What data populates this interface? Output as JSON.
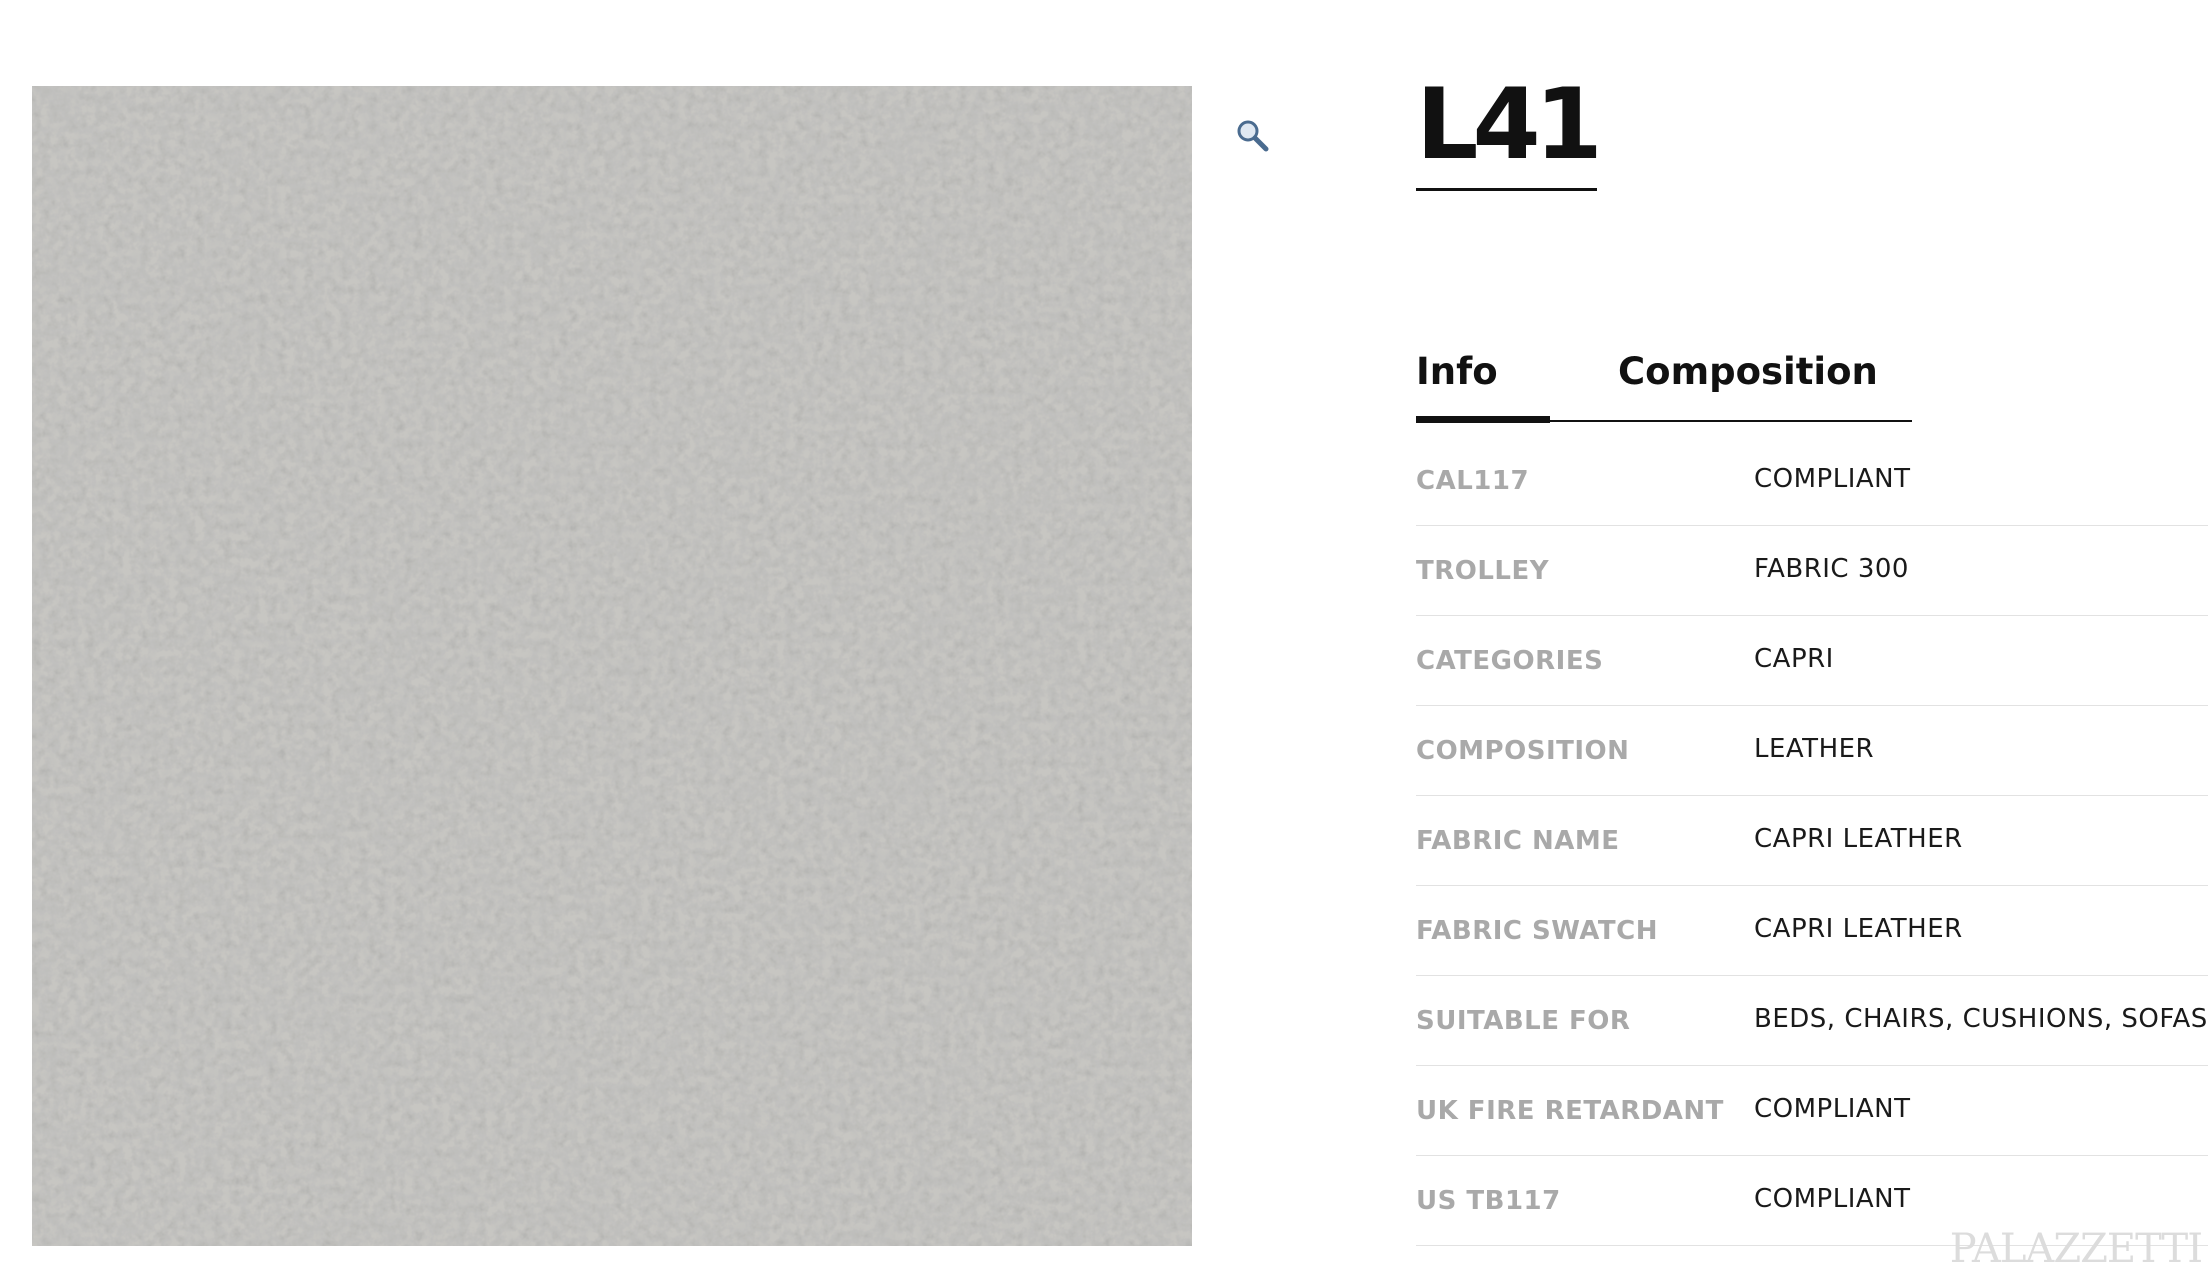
{
  "product": {
    "title": "L41",
    "image_alt": "L41 leather swatch"
  },
  "tabs": [
    {
      "label": "Info",
      "active": true
    },
    {
      "label": "Composition",
      "active": false
    }
  ],
  "specs": [
    {
      "label": "CAL117",
      "value": "COMPLIANT"
    },
    {
      "label": "TROLLEY",
      "value": "FABRIC 300"
    },
    {
      "label": "CATEGORIES",
      "value": "CAPRI"
    },
    {
      "label": "COMPOSITION",
      "value": "LEATHER"
    },
    {
      "label": "FABRIC NAME",
      "value": "CAPRI LEATHER"
    },
    {
      "label": "FABRIC SWATCH",
      "value": "CAPRI LEATHER"
    },
    {
      "label": "SUITABLE FOR",
      "value": "BEDS, CHAIRS, CUSHIONS, SOFAS"
    },
    {
      "label": "UK FIRE RETARDANT",
      "value": "COMPLIANT"
    },
    {
      "label": "US TB117",
      "value": "COMPLIANT"
    }
  ],
  "watermark": "PALAZZETTI",
  "icons": {
    "zoom": "magnifier-icon"
  },
  "colors": {
    "swatch_base": "#c4c3bf",
    "label_gray": "#a9a9a9",
    "text_dark": "#111111"
  }
}
